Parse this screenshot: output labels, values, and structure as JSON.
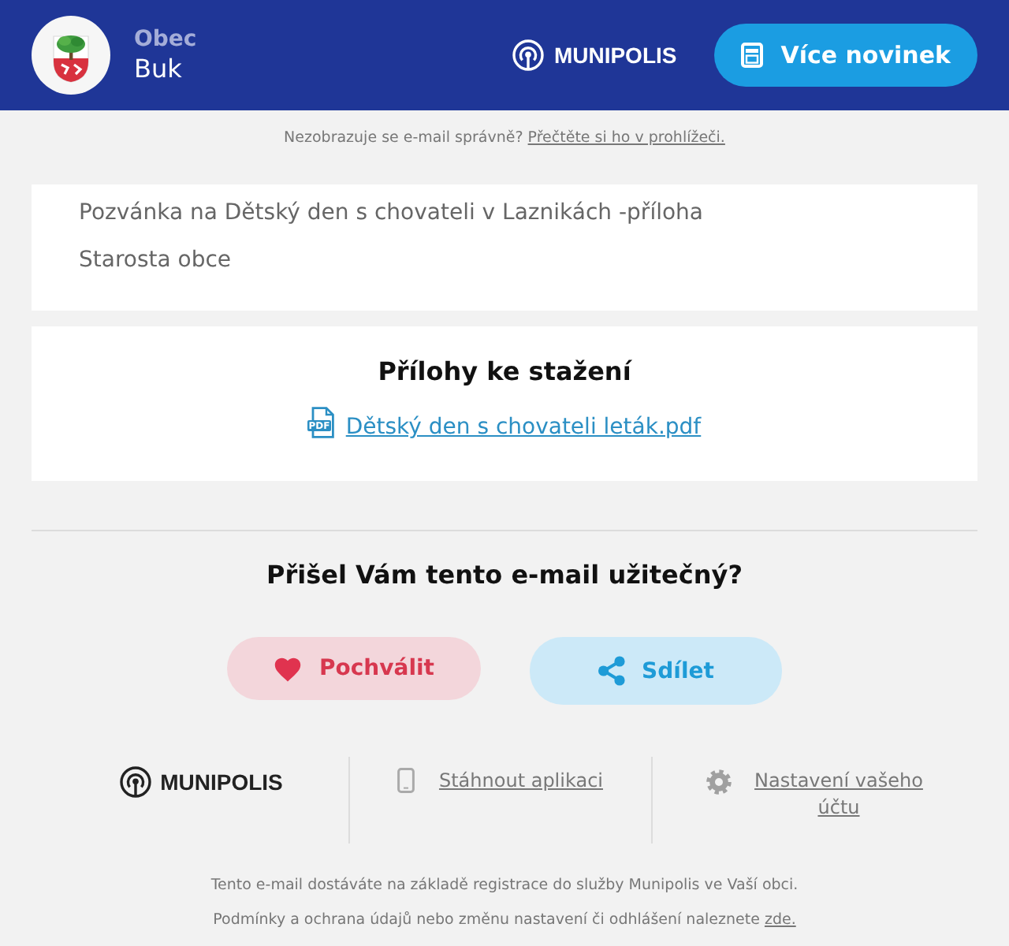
{
  "header": {
    "municipality_type": "Obec",
    "municipality_name": "Buk",
    "brand": "MUNIPOLIS",
    "more_news_button": "Více novinek"
  },
  "notice": {
    "text": "Nezobrazuje se e-mail správně?",
    "link": "Přečtěte si ho v prohlížeči."
  },
  "message": {
    "lines": [
      "Pozvánka na Dětský den s chovateli v Laznikách -příloha",
      "Starosta obce"
    ]
  },
  "attachments": {
    "title": "Přílohy ke stažení",
    "files": [
      {
        "kind": "pdf",
        "badge": "PDF",
        "name": "Dětský den s chovateli leták.pdf"
      }
    ]
  },
  "feedback": {
    "question": "Přišel Vám tento e-mail užitečný?",
    "buttons": [
      {
        "kind": "praise",
        "label": "Pochválit"
      },
      {
        "kind": "share",
        "label": "Sdílet"
      }
    ]
  },
  "footer": {
    "brand": "MUNIPOLIS",
    "links": [
      {
        "kind": "app",
        "label": "Stáhnout aplikaci"
      },
      {
        "kind": "settings",
        "label": "Nastavení vašeho účtu"
      }
    ],
    "notes": [
      {
        "text": "Tento e-mail dostáváte na základě registrace do služby Munipolis ve Vaší obci."
      },
      {
        "text": "Podmínky a ochrana údajů nebo změnu nastavení či odhlášení naleznete",
        "link": "zde."
      }
    ]
  }
}
